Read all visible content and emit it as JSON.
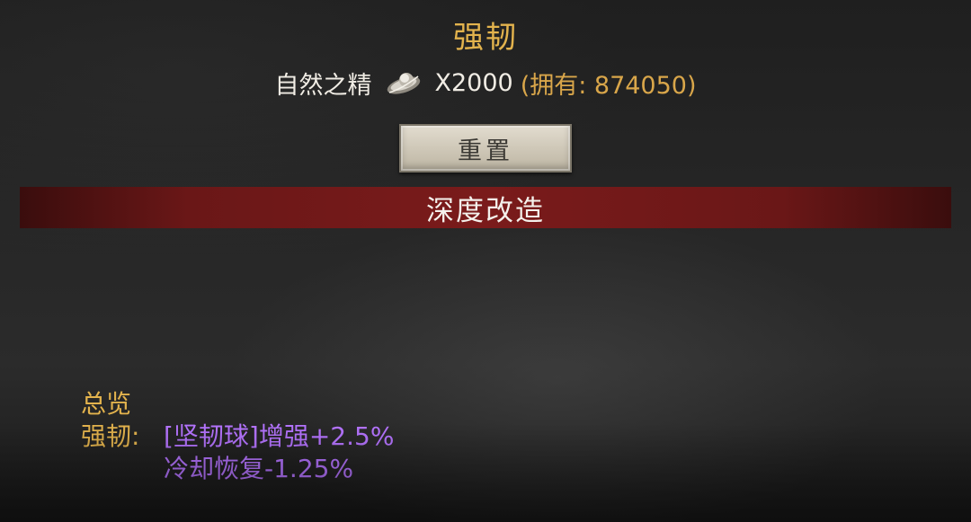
{
  "upgrade": {
    "title": "强韧",
    "cost": {
      "item_name": "自然之精",
      "icon": "nature-essence-icon",
      "amount": "X2000",
      "owned": "(拥有: 874050)"
    },
    "reset_label": "重置"
  },
  "section": {
    "title": "深度改造"
  },
  "summary": {
    "title": "总览",
    "stat_label": "强韧:",
    "stat_lines": [
      "[坚韧球]增强+2.5%",
      "冷却恢复-1.25%"
    ]
  },
  "colors": {
    "gold": "#e3b34d",
    "purple": "#b574ff",
    "banner_red": "#7a1b1b"
  }
}
